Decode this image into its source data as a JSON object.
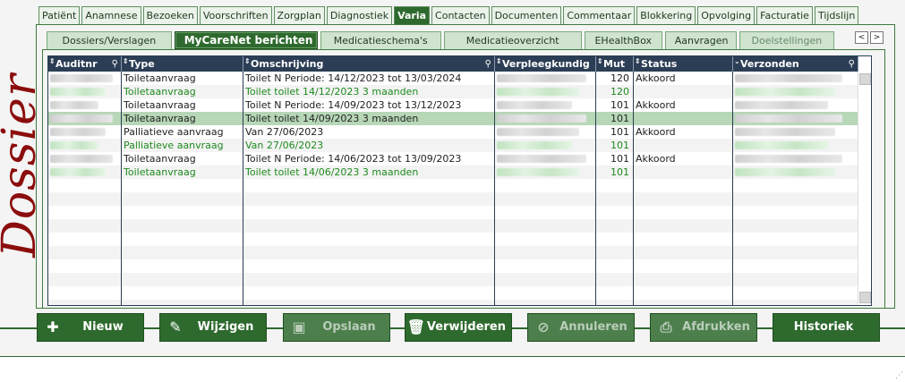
{
  "side_title": "Dossier",
  "top_tabs": [
    "Patiënt",
    "Anamnese",
    "Bezoeken",
    "Voorschriften",
    "Zorgplan",
    "Diagnostiek",
    "Varia",
    "Contacten",
    "Documenten",
    "Commentaar",
    "Blokkering",
    "Opvolging",
    "Facturatie",
    "Tijdslijn"
  ],
  "top_tab_active": "Varia",
  "sub_tabs": [
    "Dossiers/Verslagen",
    "MyCareNet berichten",
    "Medicatieschema's",
    "Medicatieoverzicht",
    "EHealthBox",
    "Aanvragen",
    "Doelstellingen"
  ],
  "sub_tab_active": "MyCareNet berichten",
  "tab_nav": {
    "prev": "<",
    "next": ">"
  },
  "columns": [
    "Auditnr",
    "Type",
    "Omschrijving",
    "Verpleegkundig",
    "Mut",
    "Status",
    "Verzonden"
  ],
  "rows": [
    {
      "type": "Toiletaanvraag",
      "omschrijving": "Toilet N Periode: 14/12/2023 tot 13/03/2024",
      "mut": "120",
      "status": "Akkoord",
      "green": false,
      "selected": false
    },
    {
      "type": "Toiletaanvraag",
      "omschrijving": "Toilet toilet 14/12/2023 3 maanden",
      "mut": "120",
      "status": "",
      "green": true,
      "selected": false
    },
    {
      "type": "Toiletaanvraag",
      "omschrijving": "Toilet N Periode: 14/09/2023 tot 13/12/2023",
      "mut": "101",
      "status": "Akkoord",
      "green": false,
      "selected": false
    },
    {
      "type": "Toiletaanvraag",
      "omschrijving": "Toilet toilet 14/09/2023 3 maanden",
      "mut": "101",
      "status": "",
      "green": false,
      "selected": true
    },
    {
      "type": "Palliatieve aanvraag",
      "omschrijving": "Van 27/06/2023",
      "mut": "101",
      "status": "Akkoord",
      "green": false,
      "selected": false
    },
    {
      "type": "Palliatieve aanvraag",
      "omschrijving": "Van 27/06/2023",
      "mut": "101",
      "status": "",
      "green": true,
      "selected": false
    },
    {
      "type": "Toiletaanvraag",
      "omschrijving": "Toilet N Periode: 14/06/2023 tot 13/09/2023",
      "mut": "101",
      "status": "Akkoord",
      "green": false,
      "selected": false
    },
    {
      "type": "Toiletaanvraag",
      "omschrijving": "Toilet toilet 14/06/2023 3 maanden",
      "mut": "101",
      "status": "",
      "green": true,
      "selected": false
    }
  ],
  "empty_rows": 10,
  "buttons": [
    {
      "label": "Nieuw",
      "icon": "plus-icon",
      "enabled": true
    },
    {
      "label": "Wijzigen",
      "icon": "pencil-icon",
      "enabled": true
    },
    {
      "label": "Opslaan",
      "icon": "save-icon",
      "enabled": false
    },
    {
      "label": "Verwijderen",
      "icon": "trash-icon",
      "enabled": true
    },
    {
      "label": "Annuleren",
      "icon": "cancel-icon",
      "enabled": false
    },
    {
      "label": "Afdrukken",
      "icon": "printer-icon",
      "enabled": false
    },
    {
      "label": "Historiek",
      "icon": "",
      "enabled": true
    }
  ],
  "colors": {
    "accent": "#2e6a2e",
    "header": "#2c3e55",
    "title": "#8b0d0d",
    "green_text": "#1e8a1e",
    "selected_row": "#b7d7b7"
  }
}
